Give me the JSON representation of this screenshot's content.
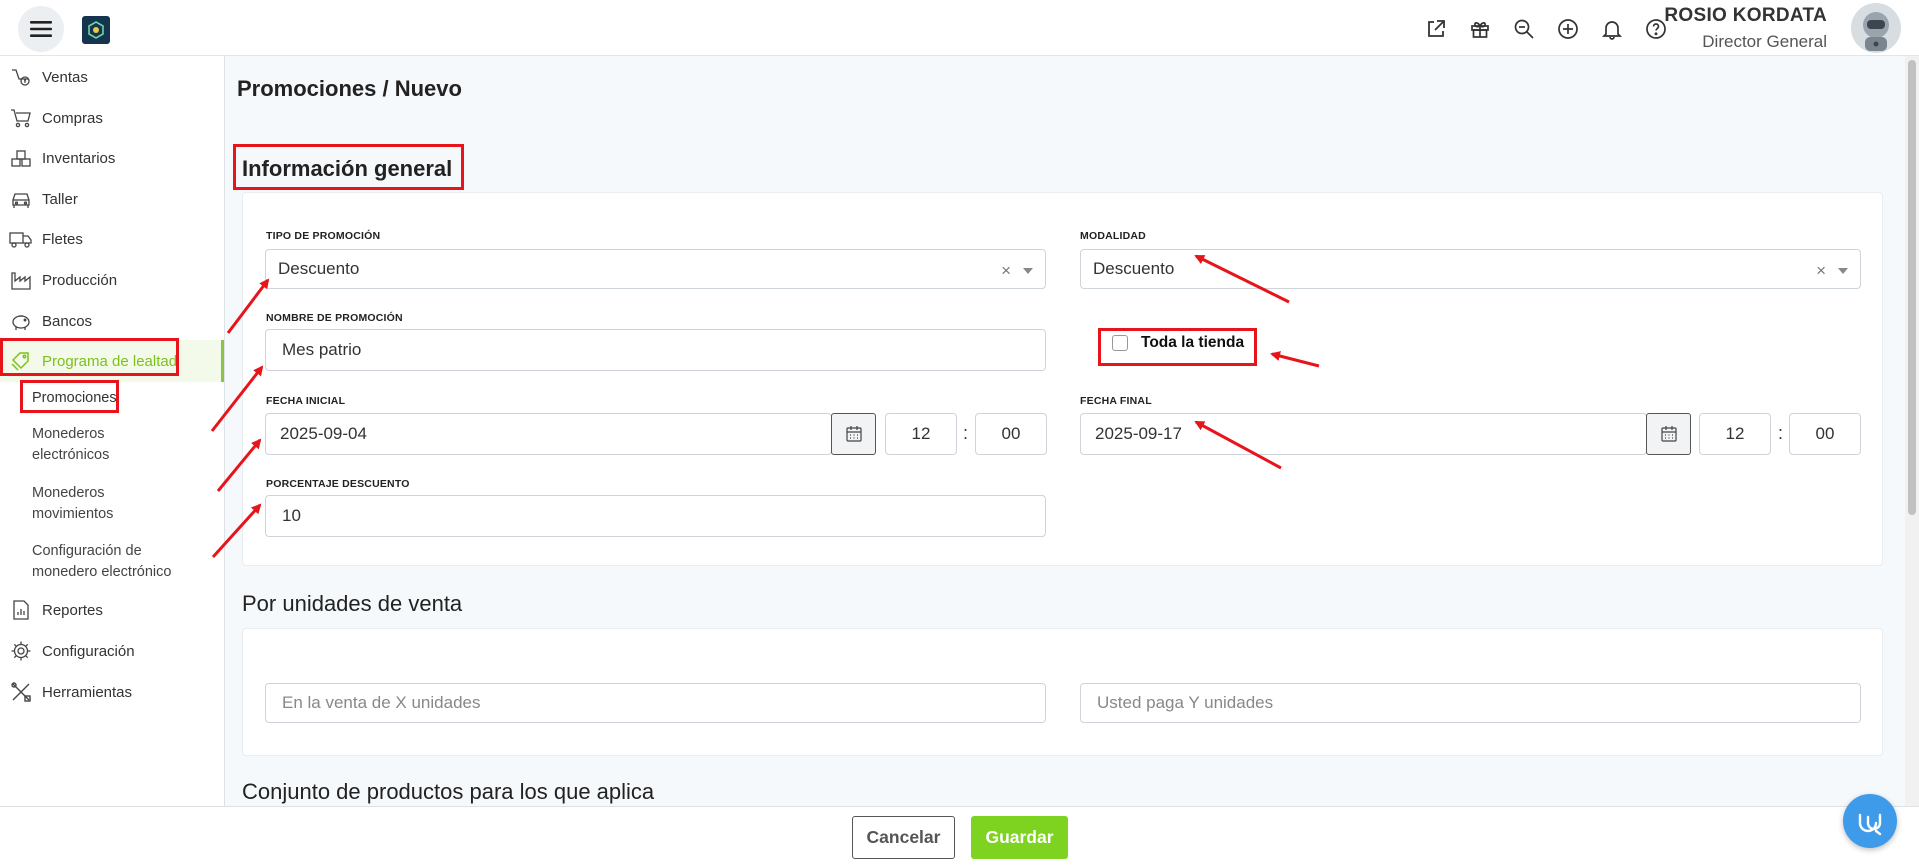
{
  "header": {
    "user_name": "ROSIO KORDATA",
    "user_role": "Director General",
    "icons": [
      "external-link-icon",
      "gift-icon",
      "search-zoom-icon",
      "plus-circle-icon",
      "bell-icon",
      "help-icon"
    ]
  },
  "sidebar": {
    "items": [
      {
        "label": "Ventas",
        "icon": "sales-icon"
      },
      {
        "label": "Compras",
        "icon": "cart-icon"
      },
      {
        "label": "Inventarios",
        "icon": "boxes-icon"
      },
      {
        "label": "Taller",
        "icon": "car-icon"
      },
      {
        "label": "Fletes",
        "icon": "truck-icon"
      },
      {
        "label": "Producción",
        "icon": "factory-icon"
      },
      {
        "label": "Bancos",
        "icon": "piggy-bank-icon"
      },
      {
        "label": "Programa de lealtad",
        "icon": "loyalty-icon",
        "active": true
      },
      {
        "label": "Reportes",
        "icon": "report-icon"
      },
      {
        "label": "Configuración",
        "icon": "gear-icon"
      },
      {
        "label": "Herramientas",
        "icon": "tools-icon"
      }
    ],
    "subitems": [
      {
        "line1": "Promociones",
        "line2": ""
      },
      {
        "line1": "Monederos",
        "line2": "electrónicos"
      },
      {
        "line1": "Monederos",
        "line2": "movimientos"
      },
      {
        "line1": "Configuración de",
        "line2": "monedero electrónico"
      }
    ]
  },
  "breadcrumb": "Promociones /  Nuevo",
  "general": {
    "title": "Información general",
    "tipo_label": "TIPO DE PROMOCIÓN",
    "tipo_value": "Descuento",
    "modalidad_label": "MODALIDAD",
    "modalidad_value": "Descuento",
    "nombre_label": "NOMBRE DE PROMOCIÓN",
    "nombre_value": "Mes patrio",
    "toda_tienda_label": "Toda la tienda",
    "toda_tienda_checked": false,
    "fecha_inicial_label": "FECHA INICIAL",
    "fecha_inicial_value": "2025-09-04",
    "fecha_inicial_hour": "12",
    "fecha_inicial_min": "00",
    "fecha_final_label": "FECHA FINAL",
    "fecha_final_value": "2025-09-17",
    "fecha_final_hour": "12",
    "fecha_final_min": "00",
    "colon": ":",
    "porcentaje_label": "PORCENTAJE DESCUENTO",
    "porcentaje_value": "10"
  },
  "unidades": {
    "title": "Por unidades de venta",
    "x_placeholder": "En la venta de X unidades",
    "y_placeholder": "Usted paga Y unidades"
  },
  "conjunto": {
    "title": "Conjunto de productos para los que aplica"
  },
  "footer": {
    "cancel_label": "Cancelar",
    "save_label": "Guardar"
  },
  "colors": {
    "accent_green": "#7ed321",
    "annotation_red": "#e8141b",
    "chat_blue": "#3d9be9"
  }
}
